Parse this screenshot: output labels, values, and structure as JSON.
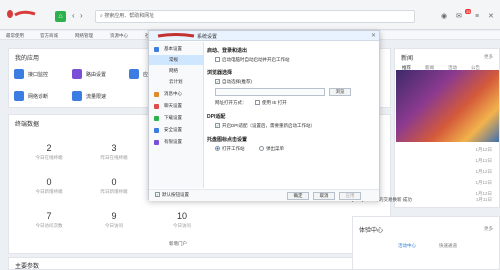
{
  "browser": {
    "address_text": "搜索应用、帮助和网址",
    "badge_count": "35",
    "bookmarks": [
      "最常使用",
      "官方商城",
      "网络管理",
      "资源中心",
      "社区",
      "帮助"
    ]
  },
  "apps_card": {
    "title": "我的应用",
    "items": [
      {
        "label": "接口监控",
        "color": "#3b7de0"
      },
      {
        "label": "路由设置",
        "color": "#7a4fd8"
      },
      {
        "label": "应",
        "color": "#3b7de0"
      },
      {
        "label": "网络诊断",
        "color": "#3b7de0"
      },
      {
        "label": "流量限速",
        "color": "#3b7de0"
      }
    ]
  },
  "stats_card": {
    "title": "终端数据",
    "rows": [
      [
        {
          "num": "2",
          "label": "今日在线终端"
        },
        {
          "num": "3",
          "label": "昨日在线终端"
        },
        {
          "num": "2",
          "label": "累计接入终端"
        }
      ],
      [
        {
          "num": "0",
          "label": "今日新增终端"
        },
        {
          "num": "0",
          "label": "昨日新增终端"
        },
        {
          "num": "0",
          "label": "本周新增终端"
        }
      ],
      [
        {
          "num": "7",
          "label": "今日访问次数"
        },
        {
          "num": "9",
          "label": "今日访问"
        },
        {
          "num": "10",
          "label": "今日访问"
        }
      ]
    ],
    "footer_link": "新增门户"
  },
  "bottom_card": {
    "title": "主要参数",
    "more": "更多"
  },
  "dialog": {
    "title": "系统设置",
    "sidebar": [
      {
        "label": "基本设置",
        "sub": false,
        "active": false,
        "color": "#3b7de0"
      },
      {
        "label": "常规",
        "sub": true,
        "active": true,
        "color": ""
      },
      {
        "label": "网络",
        "sub": true,
        "active": false,
        "color": ""
      },
      {
        "label": "云计划",
        "sub": true,
        "active": false,
        "color": ""
      },
      {
        "label": "消息中心",
        "sub": false,
        "active": false,
        "color": "#e08a2b"
      },
      {
        "label": "聊天设置",
        "sub": false,
        "active": false,
        "color": "#e04b4b"
      },
      {
        "label": "下载设置",
        "sub": false,
        "active": false,
        "color": "#2bb24c"
      },
      {
        "label": "安全设置",
        "sub": false,
        "active": false,
        "color": "#3b7de0"
      },
      {
        "label": "有限设置",
        "sub": false,
        "active": false,
        "color": "#7a4fd8"
      }
    ],
    "sections": {
      "startup": {
        "title": "启动、登录和退出",
        "opt": "启动电脑时自动启动并开启工作站"
      },
      "browser": {
        "title": "浏览器选择",
        "opt": "自动选择(推荐)",
        "browse_btn": "浏览",
        "sub_label": "网址打开方式：",
        "sub_opt": "使用 IE 打开"
      },
      "dpi": {
        "title": "DPI适配",
        "opt": "开启DPI适配（设置后，需要重新启动工作站）"
      },
      "close": {
        "title": "托盘图标点击设置",
        "opt1": "打开工作站",
        "opt2": "弹出菜单"
      }
    },
    "footer": {
      "checkbox": "默认按钮设置",
      "ok": "确定",
      "cancel": "取消",
      "apply": "应用"
    }
  },
  "right_panel": {
    "title": "新闻",
    "more": "更多",
    "tabs": [
      "推荐",
      "新闻",
      "活动",
      "公告"
    ],
    "news": [
      {
        "text": "",
        "date": "1月12日"
      },
      {
        "text": "",
        "date": "1月12日"
      },
      {
        "text": "",
        "date": "1月12日"
      },
      {
        "text": "",
        "date": "1月12日"
      },
      {
        "text": "",
        "date": "1月12日"
      },
      {
        "text": "[1.12] 2017年的交易换新 成功 ",
        "date": "1月11日"
      }
    ],
    "bottom_title": "体验中心",
    "bottom_tabs": [
      "活动中心",
      "快速通道"
    ]
  }
}
